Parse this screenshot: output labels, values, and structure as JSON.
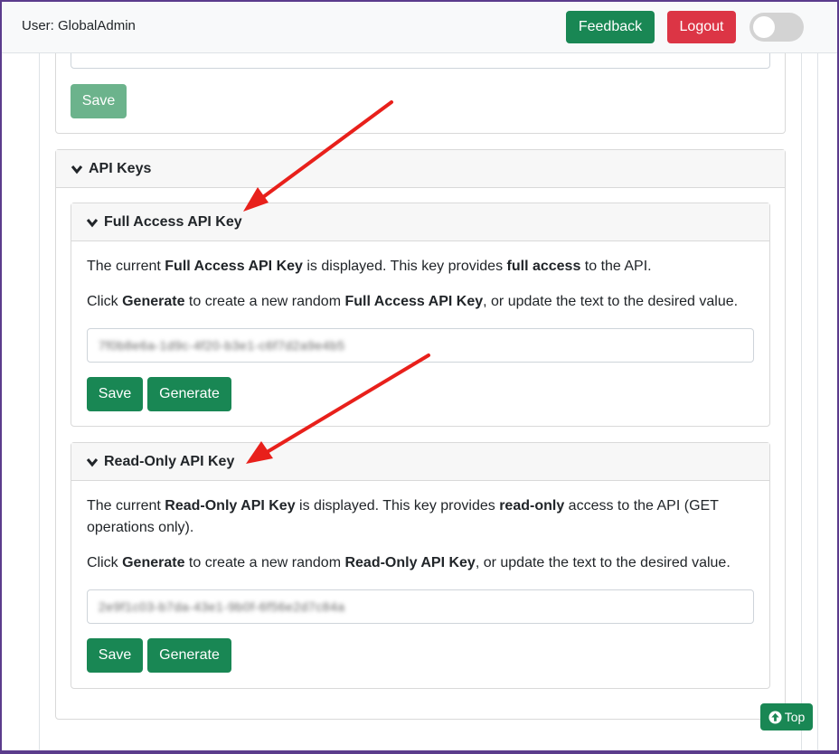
{
  "topbar": {
    "user_label": "User: GlobalAdmin",
    "feedback_label": "Feedback",
    "logout_label": "Logout"
  },
  "prev_section": {
    "save_label": "Save"
  },
  "api_keys": {
    "title": "API Keys",
    "full_access": {
      "title": "Full Access API Key",
      "desc1": [
        "The current ",
        "Full Access API Key",
        " is displayed. This key provides ",
        "full access",
        " to the API."
      ],
      "desc2": [
        "Click ",
        "Generate",
        " to create a new random ",
        "Full Access API Key",
        ", or update the text to the desired value."
      ],
      "value": "7f0b8e6a-1d9c-4f20-b3e1-c6f7d2a9e4b5",
      "save_label": "Save",
      "generate_label": "Generate"
    },
    "read_only": {
      "title": "Read-Only API Key",
      "desc1": [
        "The current ",
        "Read-Only API Key",
        " is displayed. This key provides ",
        "read-only",
        " access to the API (GET operations only)."
      ],
      "desc2": [
        "Click ",
        "Generate",
        " to create a new random ",
        "Read-Only API Key",
        ", or update the text to the desired value."
      ],
      "value": "2e9f1c03-b7da-43e1-9b0f-6f56e2d7c84a",
      "save_label": "Save",
      "generate_label": "Generate"
    }
  },
  "top_button_label": "Top",
  "colors": {
    "accent_green": "#198754",
    "danger_red": "#dc3545",
    "annotation_red": "#e8201b"
  }
}
